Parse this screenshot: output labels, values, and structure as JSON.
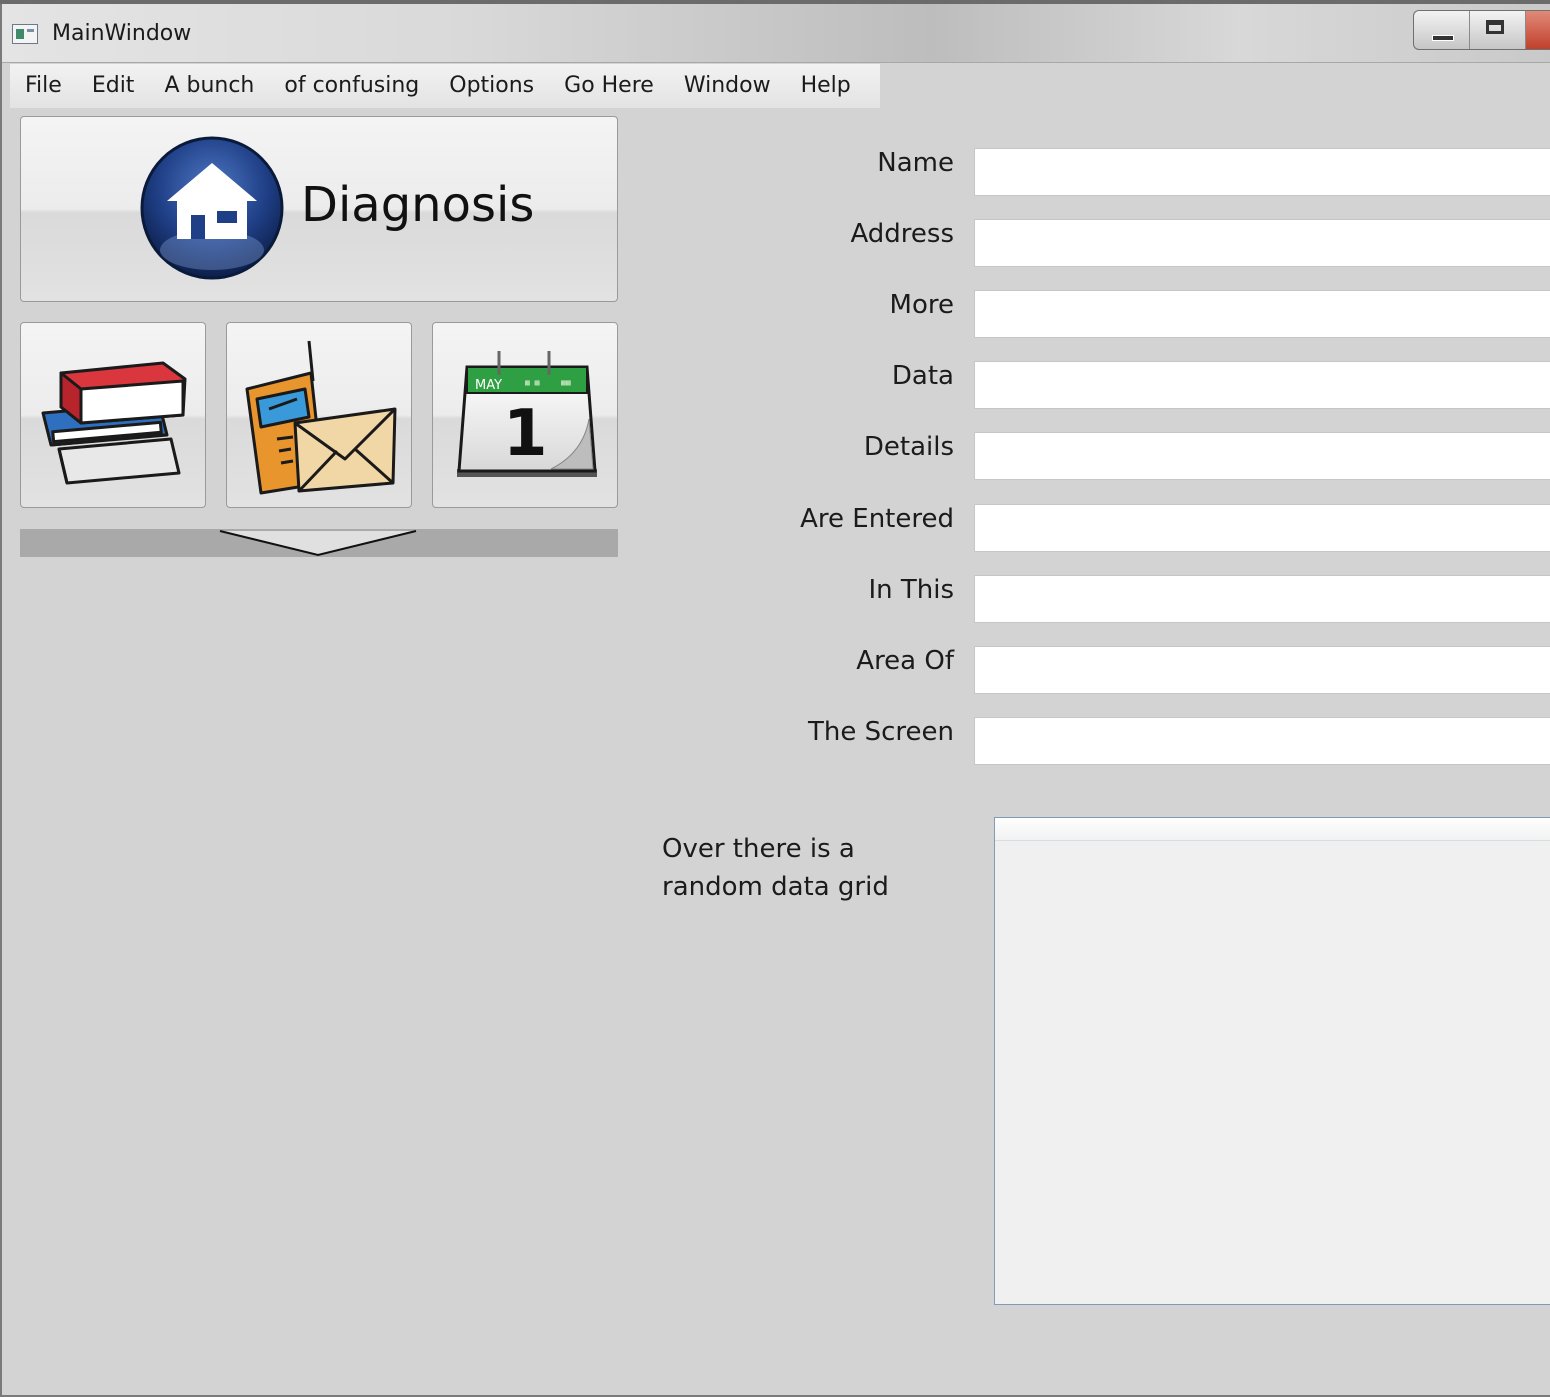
{
  "window": {
    "title": "MainWindow"
  },
  "menu": {
    "items": [
      {
        "label": "File"
      },
      {
        "label": "Edit"
      },
      {
        "label": "A bunch"
      },
      {
        "label": "of confusing"
      },
      {
        "label": "Options"
      },
      {
        "label": "Go Here"
      },
      {
        "label": "Window"
      },
      {
        "label": "Help"
      }
    ]
  },
  "left_panel": {
    "diagnosis_label": "Diagnosis",
    "tiles": [
      {
        "icon": "books-icon"
      },
      {
        "icon": "phone-mail-icon"
      },
      {
        "icon": "calendar-icon",
        "month": "MAY",
        "day": "1"
      }
    ]
  },
  "form": {
    "fields": [
      {
        "label": "Name",
        "value": ""
      },
      {
        "label": "Address",
        "value": ""
      },
      {
        "label": "More",
        "value": ""
      },
      {
        "label": "Data",
        "value": ""
      },
      {
        "label": "Details",
        "value": ""
      },
      {
        "label": "Are Entered",
        "value": ""
      },
      {
        "label": "In This",
        "value": ""
      },
      {
        "label": "Area Of",
        "value": ""
      },
      {
        "label": "The Screen",
        "value": ""
      }
    ],
    "grid_note": "Over there is a random data grid"
  },
  "colors": {
    "window_bg": "#d3d3d3",
    "home_orb": "#1f3f86",
    "calendar_green": "#2ea043",
    "book_red": "#d9363e",
    "book_blue": "#2f6fbf"
  }
}
